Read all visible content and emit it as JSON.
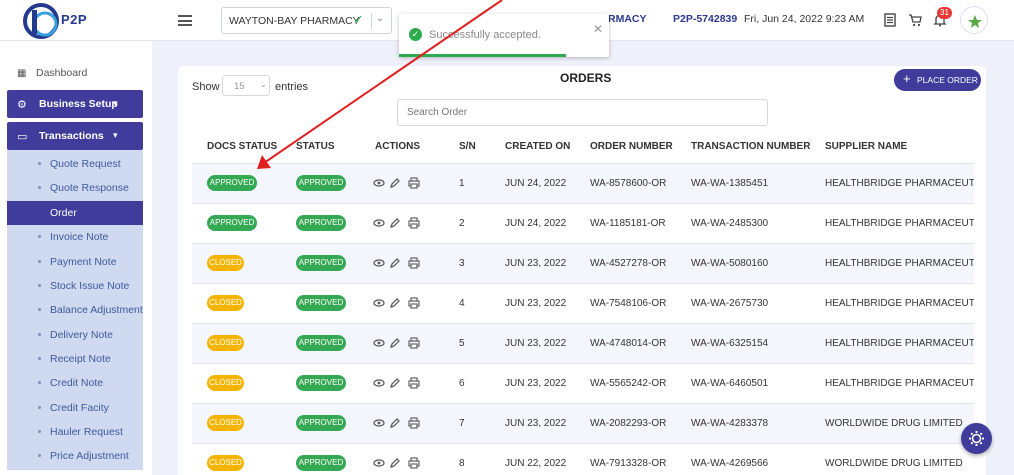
{
  "header": {
    "logo_text": "P2P",
    "pharmacy_select": "WAYTON-BAY PHARMACY",
    "pharmacy_label_right": "RMACY",
    "p2p_id": "P2P-5742839",
    "datetime": "Fri, Jun 24, 2022 9:23 AM",
    "notification_count": "31"
  },
  "toast": {
    "message": "Successfully accepted.",
    "progress": 0.8
  },
  "sidebar": {
    "dashboard": "Dashboard",
    "business_setup": "Business Setup",
    "transactions": "Transactions",
    "items": [
      {
        "label": "Quote Request"
      },
      {
        "label": "Quote Response"
      },
      {
        "label": "Order"
      },
      {
        "label": "Invoice Note"
      },
      {
        "label": "Payment Note"
      },
      {
        "label": "Stock Issue Note"
      },
      {
        "label": "Balance Adjustment"
      },
      {
        "label": "Delivery Note"
      },
      {
        "label": "Receipt Note"
      },
      {
        "label": "Credit Note"
      },
      {
        "label": "Credit Facity"
      },
      {
        "label": "Hauler Request"
      },
      {
        "label": "Price Adjustment"
      }
    ],
    "active_item": "Order"
  },
  "main": {
    "show_label": "Show",
    "page_size": "15",
    "entries_label": "entries",
    "title": "ORDERS",
    "place_order": "PLACE ORDER",
    "search_placeholder": "Search Order",
    "columns": [
      "DOCS STATUS",
      "STATUS",
      "ACTIONS",
      "S/N",
      "CREATED ON",
      "ORDER NUMBER",
      "TRANSACTION NUMBER",
      "SUPPLIER NAME"
    ],
    "rows": [
      {
        "docs_status": "APPROVED",
        "status": "APPROVED",
        "sn": "1",
        "created": "JUN 24, 2022",
        "order": "WA-8578600-OR",
        "txn": "WA-WA-1385451",
        "supplier": "HEALTHBRIDGE PHARMACEUTICALS"
      },
      {
        "docs_status": "APPROVED",
        "status": "APPROVED",
        "sn": "2",
        "created": "JUN 24, 2022",
        "order": "WA-1185181-OR",
        "txn": "WA-WA-2485300",
        "supplier": "HEALTHBRIDGE PHARMACEUTICALS"
      },
      {
        "docs_status": "CLOSED",
        "status": "APPROVED",
        "sn": "3",
        "created": "JUN 23, 2022",
        "order": "WA-4527278-OR",
        "txn": "WA-WA-5080160",
        "supplier": "HEALTHBRIDGE PHARMACEUTICALS"
      },
      {
        "docs_status": "CLOSED",
        "status": "APPROVED",
        "sn": "4",
        "created": "JUN 23, 2022",
        "order": "WA-7548106-OR",
        "txn": "WA-WA-2675730",
        "supplier": "HEALTHBRIDGE PHARMACEUTICALS"
      },
      {
        "docs_status": "CLOSED",
        "status": "APPROVED",
        "sn": "5",
        "created": "JUN 23, 2022",
        "order": "WA-4748014-OR",
        "txn": "WA-WA-6325154",
        "supplier": "HEALTHBRIDGE PHARMACEUTICALS"
      },
      {
        "docs_status": "CLOSED",
        "status": "APPROVED",
        "sn": "6",
        "created": "JUN 23, 2022",
        "order": "WA-5565242-OR",
        "txn": "WA-WA-6460501",
        "supplier": "HEALTHBRIDGE PHARMACEUTICALS"
      },
      {
        "docs_status": "CLOSED",
        "status": "APPROVED",
        "sn": "7",
        "created": "JUN 23, 2022",
        "order": "WA-2082293-OR",
        "txn": "WA-WA-4283378",
        "supplier": "WORLDWIDE DRUG LIMITED"
      },
      {
        "docs_status": "CLOSED",
        "status": "APPROVED",
        "sn": "8",
        "created": "JUN 22, 2022",
        "order": "WA-7913328-OR",
        "txn": "WA-WA-4269566",
        "supplier": "WORLDWIDE DRUG LIMITED"
      }
    ]
  },
  "colors": {
    "primary": "#3f3c9b",
    "approved": "#35a853",
    "closed": "#f4b400",
    "annotation_arrow": "#e02020"
  }
}
